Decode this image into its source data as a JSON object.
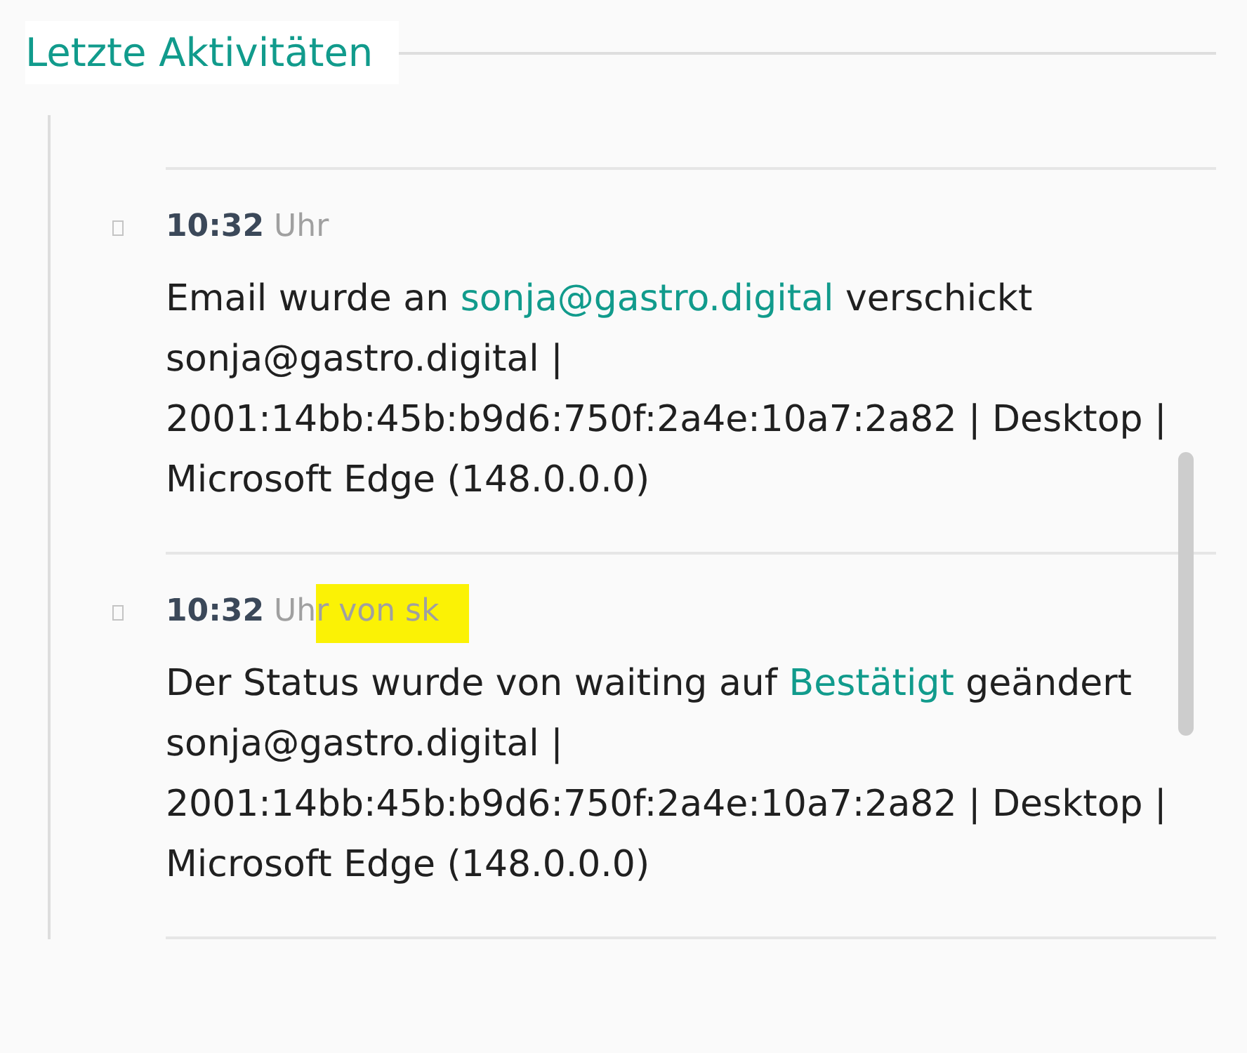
{
  "section": {
    "title": "Letzte Aktivitäten"
  },
  "activities": [
    {
      "time": "10:32",
      "meta": "Uhr",
      "highlighted": false,
      "description": [
        {
          "kind": "text",
          "text": "Email wurde an "
        },
        {
          "kind": "link",
          "text": "sonja@gastro.digital"
        },
        {
          "kind": "text",
          "text": " verschickt"
        }
      ],
      "details": "sonja@gastro.digital | 2001:14bb:45b:b9d6:750f:2a4e:10a7:2a82 | Desktop | Microsoft Edge (148.0.0.0)"
    },
    {
      "time": "10:32",
      "meta": "Uhr von sk",
      "highlighted": true,
      "description": [
        {
          "kind": "text",
          "text": "Der Status wurde von waiting auf "
        },
        {
          "kind": "link",
          "text": "Bestätigt"
        },
        {
          "kind": "text",
          "text": " geändert"
        }
      ],
      "details": "sonja@gastro.digital | 2001:14bb:45b:b9d6:750f:2a4e:10a7:2a82 | Desktop | Microsoft Edge (148.0.0.0)"
    }
  ]
}
